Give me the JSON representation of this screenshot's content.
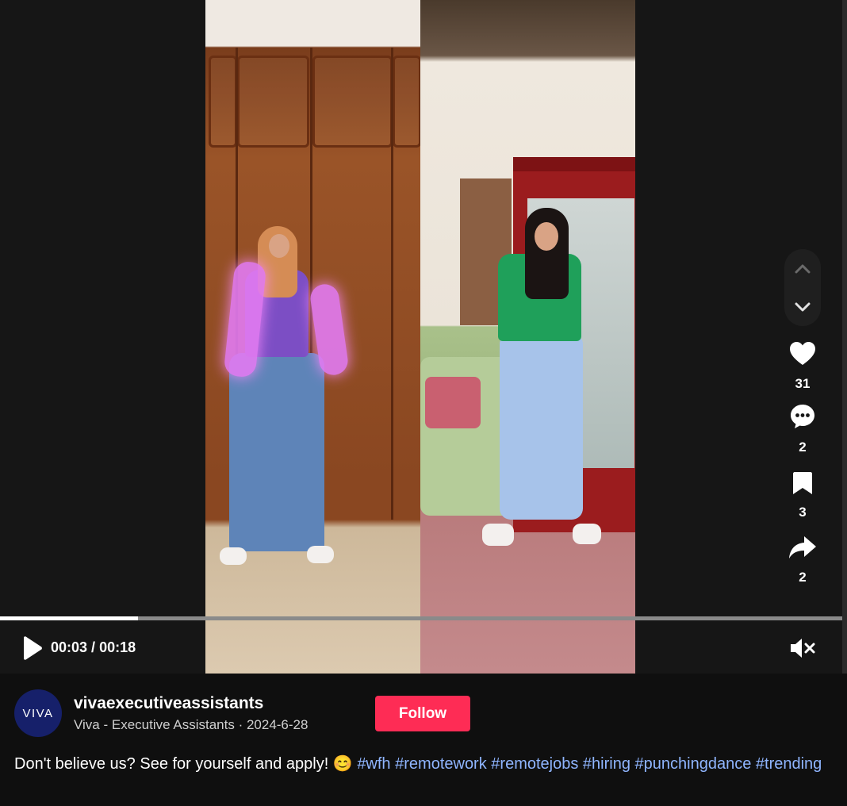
{
  "player": {
    "time_current": "00:03",
    "time_total": "00:18",
    "time_separator": " / ",
    "progress_fraction": 0.1639
  },
  "actions": {
    "likes": "31",
    "comments": "2",
    "bookmarks": "3",
    "shares": "2"
  },
  "icons": {
    "nav_up": "chevron-up-icon",
    "nav_down": "chevron-down-icon",
    "like": "heart-icon",
    "comment": "comment-icon",
    "bookmark": "bookmark-icon",
    "share": "share-icon",
    "play": "play-icon",
    "mute": "speaker-muted-icon"
  },
  "author": {
    "avatar_text": "VIVA",
    "username": "vivaexecutiveassistants",
    "display_name": "Viva - Executive Assistants",
    "separator": " · ",
    "date": "2024-6-28",
    "follow_label": "Follow"
  },
  "caption": {
    "text": "Don't believe us? See for yourself and apply! ",
    "emoji": "😊",
    "hashtags": [
      "#wfh",
      "#remotework",
      "#remotejobs",
      "#hiring",
      "#punchingdance",
      "#trending"
    ]
  },
  "colors": {
    "follow": "#fe2c55",
    "hashtag": "#8fb5ff",
    "background": "#0f0f0f"
  }
}
